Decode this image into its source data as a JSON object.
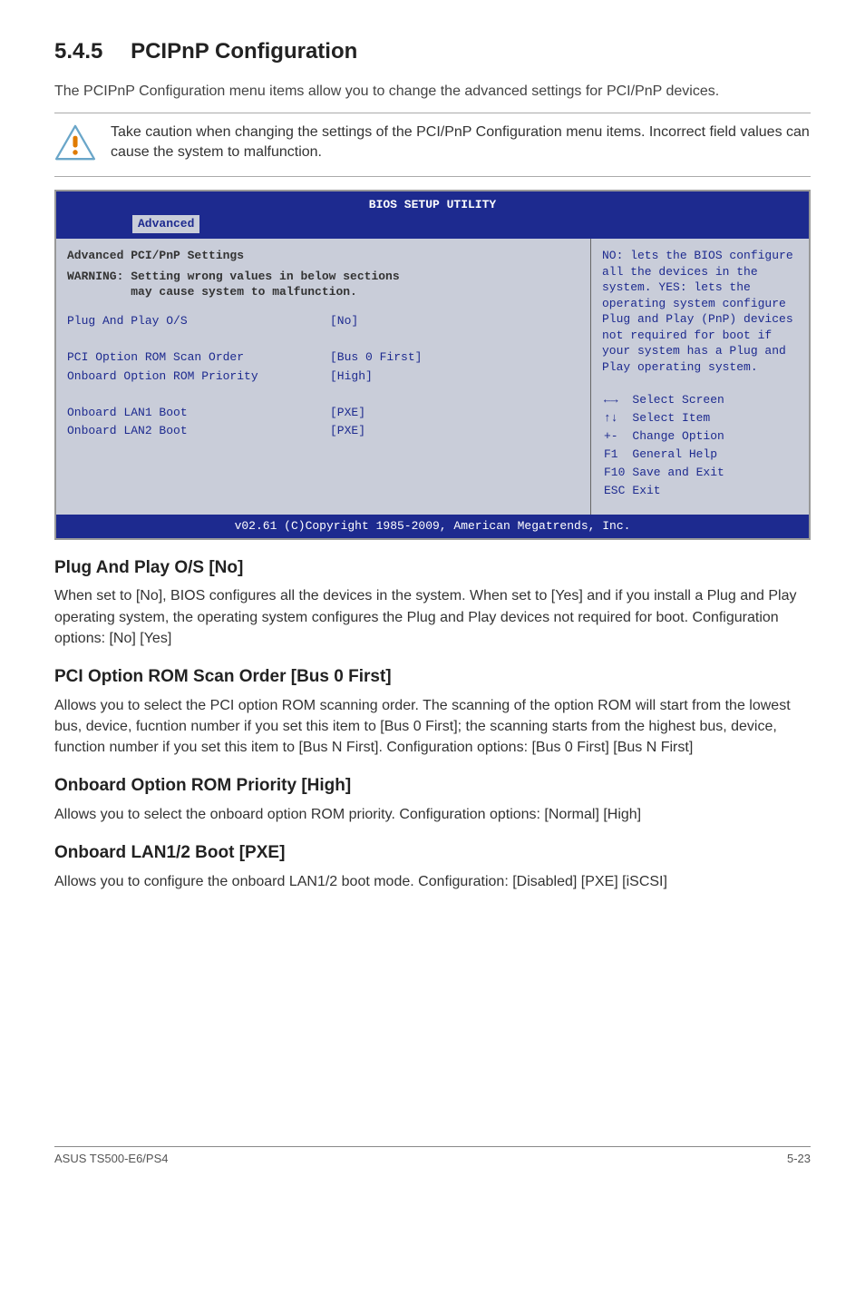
{
  "section": {
    "number": "5.4.5",
    "title": "PCIPnP Configuration",
    "lead": "The PCIPnP Configuration menu items allow you to change the advanced settings for PCI/PnP devices."
  },
  "alert": {
    "text": "Take caution when changing the settings of the PCI/PnP Configuration menu items. Incorrect field values can cause the system to malfunction."
  },
  "bios": {
    "title": "BIOS SETUP UTILITY",
    "tab": "Advanced",
    "left": {
      "header": "Advanced PCI/PnP Settings",
      "warning1": "WARNING: Setting wrong values in below sections",
      "warning2": "may cause system to malfunction.",
      "rows": [
        {
          "k": "Plug And Play O/S",
          "v": "[No]"
        },
        {
          "k": "",
          "v": ""
        },
        {
          "k": "PCI Option ROM Scan Order",
          "v": "[Bus 0 First]"
        },
        {
          "k": "Onboard Option ROM Priority",
          "v": "[High]"
        },
        {
          "k": "",
          "v": ""
        },
        {
          "k": "Onboard LAN1 Boot",
          "v": "[PXE]"
        },
        {
          "k": "Onboard LAN2 Boot",
          "v": "[PXE]"
        }
      ]
    },
    "right": {
      "help": "NO: lets the BIOS configure all the devices in the system. YES: lets the operating system configure Plug and Play (PnP) devices not required for boot if your system has a Plug and Play operating system.",
      "keys": [
        {
          "k": "←→",
          "v": "Select Screen"
        },
        {
          "k": "↑↓",
          "v": "Select Item"
        },
        {
          "k": "+-",
          "v": "Change Option"
        },
        {
          "k": "F1",
          "v": "General Help"
        },
        {
          "k": "F10",
          "v": "Save and Exit"
        },
        {
          "k": "ESC",
          "v": "Exit"
        }
      ]
    },
    "footer": "v02.61 (C)Copyright 1985-2009, American Megatrends, Inc."
  },
  "subs": [
    {
      "title": "Plug And Play O/S [No]",
      "body": "When set to [No], BIOS configures all the devices in the system. When set to [Yes] and if you install a Plug and Play operating system, the operating system configures the Plug and Play devices not required for boot. Configuration options: [No] [Yes]"
    },
    {
      "title": "PCI Option ROM Scan Order [Bus 0 First]",
      "body": "Allows you to select the PCI option ROM scanning order. The scanning of the option ROM will start from the lowest bus, device, fucntion number if you set this item to [Bus 0 First]; the scanning starts from the highest bus, device, function number if you set this item to [Bus N First]. Configuration options: [Bus 0 First] [Bus N First]"
    },
    {
      "title": "Onboard Option ROM Priority [High]",
      "body": "Allows you to select the onboard option ROM priority. Configuration options: [Normal] [High]"
    },
    {
      "title": "Onboard LAN1/2 Boot [PXE]",
      "body": "Allows you to configure the onboard LAN1/2 boot mode. Configuration: [Disabled] [PXE] [iSCSI]"
    }
  ],
  "footer": {
    "left": "ASUS TS500-E6/PS4",
    "right": "5-23"
  }
}
